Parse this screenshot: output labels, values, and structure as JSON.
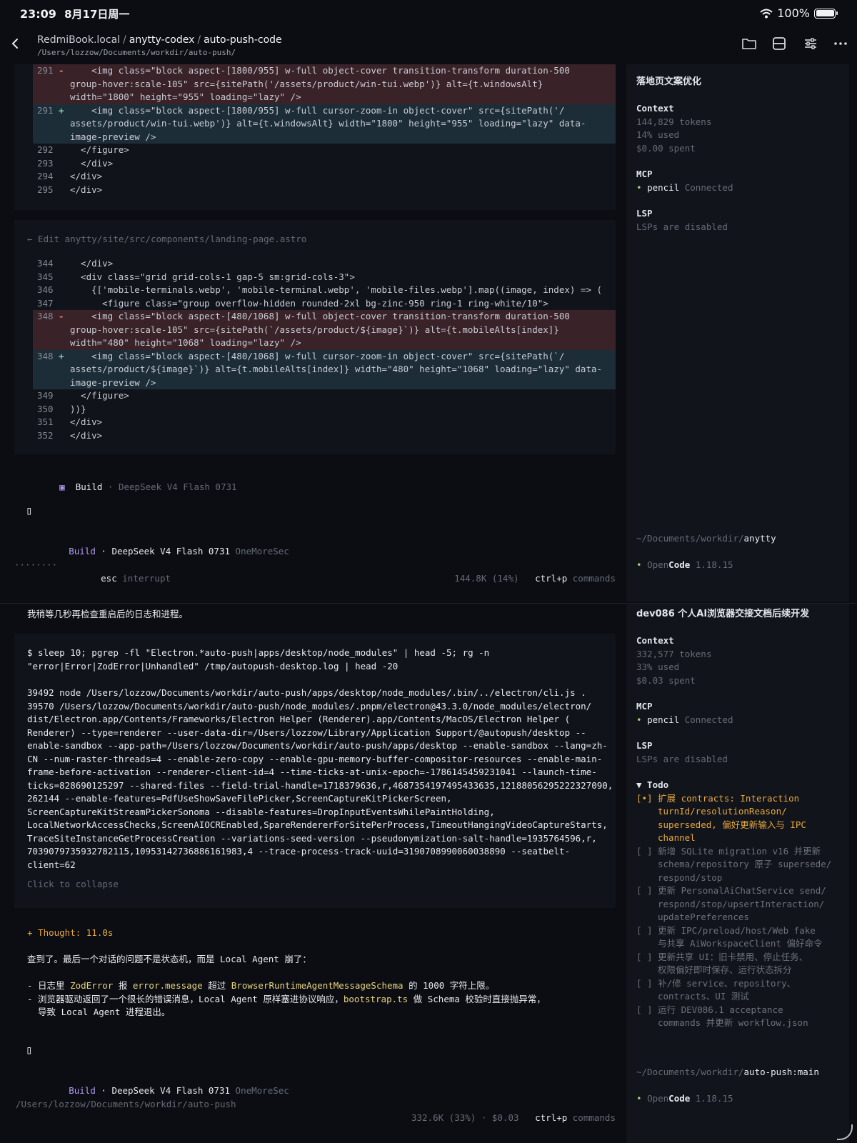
{
  "status_bar": {
    "time": "23:09",
    "date": "8月17日周一",
    "battery": "100%"
  },
  "header": {
    "host": "RedmiBook.local",
    "project": "anytty-codex",
    "branch": "auto-push-code",
    "path": "/Users/lozzow/Documents/workdir/auto-push/"
  },
  "pane1": {
    "diff1": {
      "lines": [
        {
          "n": "291",
          "s": "-",
          "type": "del",
          "text": "    <img class=\"block aspect-[1800/955] w-full object-cover transition-transform duration-500"
        },
        {
          "n": "",
          "s": "",
          "type": "del",
          "text": "group-hover:scale-105\" src={sitePath('/assets/product/win-tui.webp')} alt={t.windowsAlt}"
        },
        {
          "n": "",
          "s": "",
          "type": "del",
          "text": "width=\"1800\" height=\"955\" loading=\"lazy\" />"
        },
        {
          "n": "291",
          "s": "+",
          "type": "add",
          "text": "    <img class=\"block aspect-[1800/955] w-full cursor-zoom-in object-cover\" src={sitePath('/"
        },
        {
          "n": "",
          "s": "",
          "type": "add",
          "text": "assets/product/win-tui.webp')} alt={t.windowsAlt} width=\"1800\" height=\"955\" loading=\"lazy\" data-"
        },
        {
          "n": "",
          "s": "",
          "type": "add",
          "text": "image-preview />"
        },
        {
          "n": "292",
          "s": "",
          "type": "ctx",
          "text": "  </figure>"
        },
        {
          "n": "293",
          "s": "",
          "type": "ctx",
          "text": "  </div>"
        },
        {
          "n": "294",
          "s": "",
          "type": "ctx",
          "text": "</div>"
        },
        {
          "n": "295",
          "s": "",
          "type": "ctx",
          "text": "</div>"
        }
      ]
    },
    "edit_header": "← Edit anytty/site/src/components/landing-page.astro",
    "diff2": {
      "lines": [
        {
          "n": "344",
          "s": "",
          "type": "ctx",
          "text": "  </div>"
        },
        {
          "n": "345",
          "s": "",
          "type": "ctx",
          "text": "  <div class=\"grid grid-cols-1 gap-5 sm:grid-cols-3\">"
        },
        {
          "n": "346",
          "s": "",
          "type": "ctx",
          "text": "    {['mobile-terminals.webp', 'mobile-terminal.webp', 'mobile-files.webp'].map((image, index) => ("
        },
        {
          "n": "347",
          "s": "",
          "type": "ctx",
          "text": "      <figure class=\"group overflow-hidden rounded-2xl bg-zinc-950 ring-1 ring-white/10\">"
        },
        {
          "n": "348",
          "s": "-",
          "type": "del",
          "text": "    <img class=\"block aspect-[480/1068] w-full object-cover transition-transform duration-500"
        },
        {
          "n": "",
          "s": "",
          "type": "del",
          "text": "group-hover:scale-105\" src={sitePath(`/assets/product/${image}`)} alt={t.mobileAlts[index]}"
        },
        {
          "n": "",
          "s": "",
          "type": "del",
          "text": "width=\"480\" height=\"1068\" loading=\"lazy\" />"
        },
        {
          "n": "348",
          "s": "+",
          "type": "add",
          "text": "    <img class=\"block aspect-[480/1068] w-full cursor-zoom-in object-cover\" src={sitePath(`/"
        },
        {
          "n": "",
          "s": "",
          "type": "add",
          "text": "assets/product/${image}`)} alt={t.mobileAlts[index]} width=\"480\" height=\"1068\" loading=\"lazy\" data-"
        },
        {
          "n": "",
          "s": "",
          "type": "add",
          "text": "image-preview />"
        },
        {
          "n": "349",
          "s": "",
          "type": "ctx",
          "text": "  </figure>"
        },
        {
          "n": "350",
          "s": "",
          "type": "ctx",
          "text": "))}"
        },
        {
          "n": "351",
          "s": "",
          "type": "ctx",
          "text": "</div>"
        },
        {
          "n": "352",
          "s": "",
          "type": "ctx",
          "text": "</div>"
        }
      ]
    },
    "build_label": "Build",
    "build_model": "· DeepSeek V4 Flash 0731",
    "prompt_cursor": "▯",
    "footer_agent": "Build",
    "footer_model": "· DeepSeek V4 Flash 0731",
    "footer_variant": "OneMoreSec",
    "bottom_dots": "········",
    "bottom_key": "esc",
    "bottom_action": "interrupt",
    "bottom_usage": "144.8K (14%)",
    "bottom_cmd_key": "ctrl+p",
    "bottom_cmd_label": "commands",
    "side": {
      "title": "落地页文案优化",
      "context_h": "Context",
      "tokens": "144,829 tokens",
      "used": "14% used",
      "spent": "$0.00 spent",
      "mcp_h": "MCP",
      "mcp_name": "pencil",
      "mcp_status": "Connected",
      "lsp_h": "LSP",
      "lsp_status": "LSPs are disabled",
      "cwd_prefix": "~/Documents/workdir/",
      "cwd_name": "anytty",
      "version_open": "Open",
      "version_code": "Code",
      "version_num": "1.18.15"
    }
  },
  "pane2": {
    "intro": "我稍等几秒再检查重启后的日志和进程。",
    "command": [
      "$ sleep 10; pgrep -fl \"Electron.*auto-push|apps/desktop/node_modules\" | head -5; rg -n",
      "\"error|Error|ZodError|Unhandled\" /tmp/autopush-desktop.log | head -20"
    ],
    "output": [
      "39492 node /Users/lozzow/Documents/workdir/auto-push/apps/desktop/node_modules/.bin/../electron/cli.js .",
      "39570 /Users/lozzow/Documents/workdir/auto-push/node_modules/.pnpm/electron@43.3.0/node_modules/electron/",
      "dist/Electron.app/Contents/Frameworks/Electron Helper (Renderer).app/Contents/MacOS/Electron Helper (",
      "Renderer) --type=renderer --user-data-dir=/Users/lozzow/Library/Application Support/@autopush/desktop --",
      "enable-sandbox --app-path=/Users/lozzow/Documents/workdir/auto-push/apps/desktop --enable-sandbox --lang=zh-",
      "CN --num-raster-threads=4 --enable-zero-copy --enable-gpu-memory-buffer-compositor-resources --enable-main-",
      "frame-before-activation --renderer-client-id=4 --time-ticks-at-unix-epoch=-1786145459231041 --launch-time-",
      "ticks=828690125297 --shared-files --field-trial-handle=1718379636,r,4687354197495433635,12188056295222327090,",
      "262144 --enable-features=PdfUseShowSaveFilePicker,ScreenCaptureKitPickerScreen,",
      "ScreenCaptureKitStreamPickerSonoma --disable-features=DropInputEventsWhilePaintHolding,",
      "LocalNetworkAccessChecks,ScreenAIOCREnabled,SpareRendererForSitePerProcess,TimeoutHangingVideoCaptureStarts,",
      "TraceSiteInstanceGetProcessCreation --variations-seed-version --pseudonymization-salt-handle=1935764596,r,",
      "7039079735932782115,10953142736886161983,4 --trace-process-track-uuid=3190708990060038890 --seatbelt-",
      "client=62"
    ],
    "collapse": "Click to collapse",
    "thought": "+ Thought: 11.0s",
    "summary": "查到了。最后一个对话的问题不是状态机，而是 Local Agent 崩了：",
    "bullet1": {
      "a": "- 日志里 ",
      "b": "ZodError",
      "c": " 报 ",
      "d": "error.message",
      "e": " 超过 ",
      "f": "BrowserRuntimeAgentMessageSchema",
      "g": " 的 1000 字符上限。"
    },
    "bullet2": {
      "a": "- 浏览器驱动返回了一个很长的错误消息，Local Agent 原样塞进协议响应，",
      "b": "bootstrap.ts",
      "c": " 做 Schema 校验时直接抛异常，",
      "d": "  导致 Local Agent 进程退出。"
    },
    "prompt_cursor": "▯",
    "footer_agent": "Build",
    "footer_model": "· DeepSeek V4 Flash 0731",
    "footer_variant": "OneMoreSec",
    "bottom_path": "/Users/lozzow/Documents/workdir/auto-push",
    "bottom_usage": "332.6K (33%) · $0.03",
    "bottom_cmd_key": "ctrl+p",
    "bottom_cmd_label": "commands",
    "side": {
      "title": "dev086 个人AI浏览器交接文档后续开发",
      "context_h": "Context",
      "tokens": "332,577 tokens",
      "used": "33% used",
      "spent": "$0.03 spent",
      "mcp_h": "MCP",
      "mcp_name": "pencil",
      "mcp_status": "Connected",
      "lsp_h": "LSP",
      "lsp_status": "LSPs are disabled",
      "todo_h": "▼ Todo",
      "todos": [
        {
          "mark": "[•]",
          "active": true,
          "lines": [
            "扩展 contracts: Interaction",
            "turnId/resolutionReason/",
            "superseded, 偏好更新输入与 IPC",
            "channel"
          ]
        },
        {
          "mark": "[ ]",
          "active": false,
          "lines": [
            "新增 SQLite migration v16 并更新",
            "schema/repository 原子 supersede/",
            "respond/stop"
          ]
        },
        {
          "mark": "[ ]",
          "active": false,
          "lines": [
            "更新 PersonalAiChatService send/",
            "respond/stop/upsertInteraction/",
            "updatePreferences"
          ]
        },
        {
          "mark": "[ ]",
          "active": false,
          "lines": [
            "更新 IPC/preload/host/Web fake",
            "与共享 AiWorkspaceClient 偏好命令"
          ]
        },
        {
          "mark": "[ ]",
          "active": false,
          "lines": [
            "更新共享 UI：旧卡禁用、停止任务、",
            "权限偏好即时保存、运行状态拆分"
          ]
        },
        {
          "mark": "[ ]",
          "active": false,
          "lines": [
            "补/修 service、repository、",
            "contracts、UI 测试"
          ]
        },
        {
          "mark": "[ ]",
          "active": false,
          "lines": [
            "运行 DEV086.1 acceptance",
            "commands 并更新 workflow.json"
          ]
        }
      ],
      "cwd_prefix": "~/Documents/workdir/",
      "cwd_name": "auto-push:main",
      "version_open": "Open",
      "version_code": "Code",
      "version_num": "1.18.15"
    }
  },
  "icons": [
    "back-chevron-icon",
    "folder-icon",
    "split-layout-icon",
    "sliders-icon",
    "more-icon",
    "wifi-icon",
    "battery-icon"
  ]
}
